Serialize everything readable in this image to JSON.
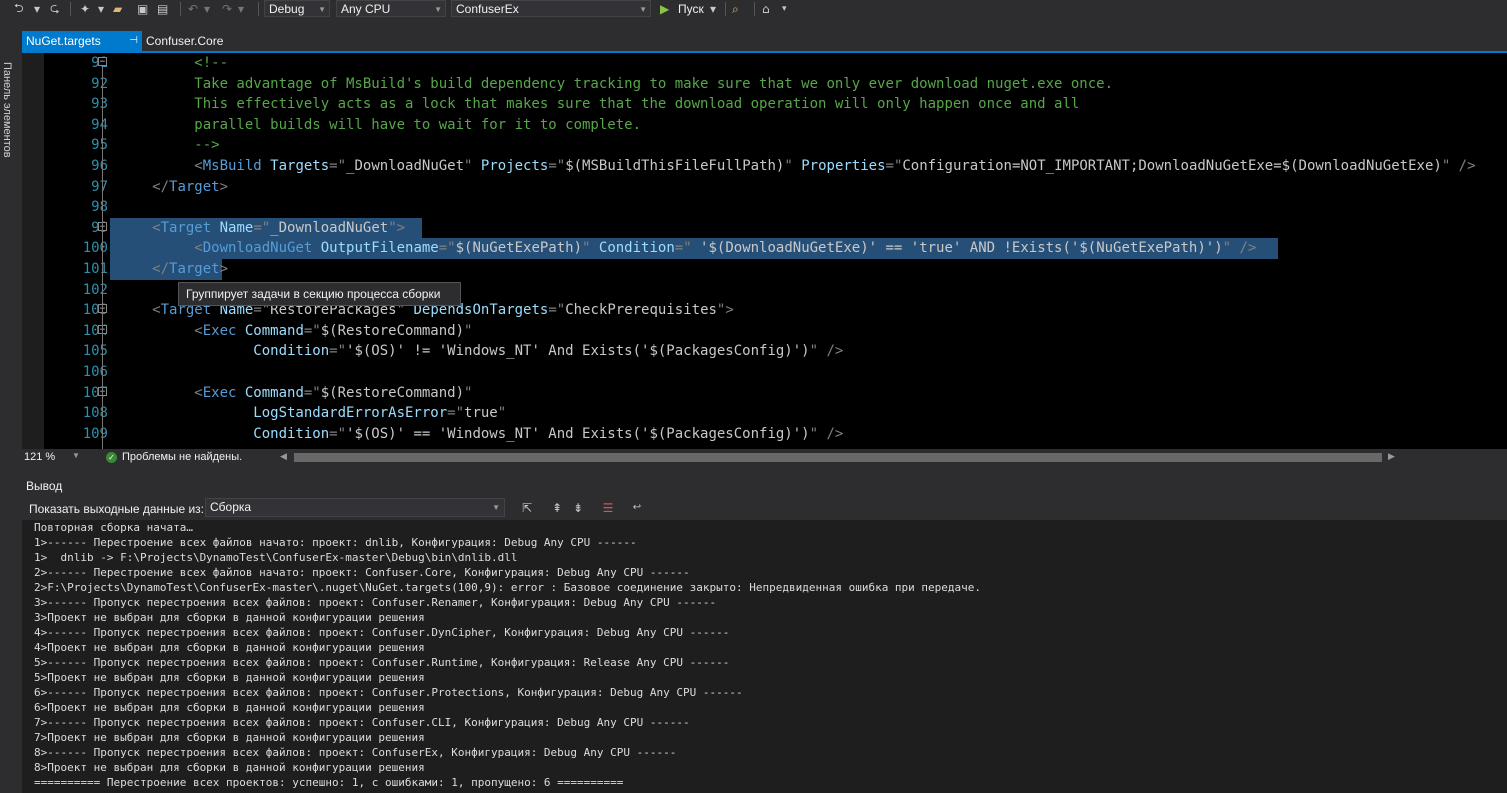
{
  "toolbar": {
    "config": "Debug",
    "platform": "Any CPU",
    "project": "ConfuserEx",
    "run_label": "Пуск"
  },
  "side_panel": {
    "label": "Панель элементов"
  },
  "tabs": [
    {
      "label": "NuGet.targets",
      "pin": "⊣"
    },
    {
      "label": "Confuser.Core"
    }
  ],
  "editor": {
    "lines": [
      {
        "n": "91",
        "fold": "⊟",
        "segs": [
          {
            "c": "c-com",
            "t": "          <!--"
          }
        ]
      },
      {
        "n": "92",
        "segs": [
          {
            "c": "c-com",
            "t": "          Take advantage of MsBuild's build dependency tracking to make sure that we only ever download nuget.exe once."
          }
        ]
      },
      {
        "n": "93",
        "segs": [
          {
            "c": "c-com",
            "t": "          This effectively acts as a lock that makes sure that the download operation will only happen once and all"
          }
        ]
      },
      {
        "n": "94",
        "segs": [
          {
            "c": "c-com",
            "t": "          parallel builds will have to wait for it to complete."
          }
        ]
      },
      {
        "n": "95",
        "segs": [
          {
            "c": "c-com",
            "t": "          -->"
          }
        ]
      },
      {
        "n": "96",
        "segs": [
          {
            "c": "c-pun",
            "t": "          <"
          },
          {
            "c": "c-tag",
            "t": "MsBuild"
          },
          {
            "c": "c-att",
            "t": " Targets"
          },
          {
            "c": "c-pun",
            "t": "=\""
          },
          {
            "c": "c-str",
            "t": "_DownloadNuGet"
          },
          {
            "c": "c-pun",
            "t": "\""
          },
          {
            "c": "c-att",
            "t": " Projects"
          },
          {
            "c": "c-pun",
            "t": "=\""
          },
          {
            "c": "c-str",
            "t": "$(MSBuildThisFileFullPath)"
          },
          {
            "c": "c-pun",
            "t": "\""
          },
          {
            "c": "c-att",
            "t": " Properties"
          },
          {
            "c": "c-pun",
            "t": "=\""
          },
          {
            "c": "c-str",
            "t": "Configuration=NOT_IMPORTANT;DownloadNuGetExe=$(DownloadNuGetExe)"
          },
          {
            "c": "c-pun",
            "t": "\" />"
          }
        ]
      },
      {
        "n": "97",
        "segs": [
          {
            "c": "c-pun",
            "t": "     </"
          },
          {
            "c": "c-tag",
            "t": "Target"
          },
          {
            "c": "c-pun",
            "t": ">"
          }
        ]
      },
      {
        "n": "98",
        "segs": [
          {
            "c": "c-pun",
            "t": ""
          }
        ]
      },
      {
        "n": "99",
        "fold": "⊟",
        "sel": true,
        "segs": [
          {
            "c": "c-pun",
            "t": "     <"
          },
          {
            "c": "c-tag",
            "t": "Target"
          },
          {
            "c": "c-att",
            "t": " Name"
          },
          {
            "c": "c-pun",
            "t": "=\""
          },
          {
            "c": "c-str",
            "t": "_DownloadNuGet"
          },
          {
            "c": "c-pun",
            "t": "\">"
          }
        ]
      },
      {
        "n": "100",
        "sel": true,
        "segs": [
          {
            "c": "c-pun",
            "t": "          <"
          },
          {
            "c": "c-tag",
            "t": "DownloadNuGet"
          },
          {
            "c": "c-att",
            "t": " OutputFilename"
          },
          {
            "c": "c-pun",
            "t": "=\""
          },
          {
            "c": "c-str",
            "t": "$(NuGetExePath)"
          },
          {
            "c": "c-pun",
            "t": "\""
          },
          {
            "c": "c-att",
            "t": " Condition"
          },
          {
            "c": "c-pun",
            "t": "=\""
          },
          {
            "c": "c-str",
            "t": " '$(DownloadNuGetExe)' == 'true' AND !Exists('$(NuGetExePath)')"
          },
          {
            "c": "c-pun",
            "t": "\" />"
          }
        ]
      },
      {
        "n": "101",
        "sel": true,
        "segs": [
          {
            "c": "c-pun",
            "t": "     </"
          },
          {
            "c": "c-tag",
            "t": "Target"
          },
          {
            "c": "c-pun",
            "t": ">"
          }
        ]
      },
      {
        "n": "102",
        "segs": [
          {
            "c": "c-pun",
            "t": ""
          }
        ]
      },
      {
        "n": "103",
        "fold": "⊟",
        "segs": [
          {
            "c": "c-pun",
            "t": "     <"
          },
          {
            "c": "c-tag",
            "t": "Target"
          },
          {
            "c": "c-att",
            "t": " Name"
          },
          {
            "c": "c-pun",
            "t": "=\""
          },
          {
            "c": "c-str",
            "t": "RestorePackages"
          },
          {
            "c": "c-pun",
            "t": "\""
          },
          {
            "c": "c-att",
            "t": " DependsOnTargets"
          },
          {
            "c": "c-pun",
            "t": "=\""
          },
          {
            "c": "c-str",
            "t": "CheckPrerequisites"
          },
          {
            "c": "c-pun",
            "t": "\">"
          }
        ]
      },
      {
        "n": "104",
        "fold": "⊟",
        "segs": [
          {
            "c": "c-pun",
            "t": "          <"
          },
          {
            "c": "c-tag",
            "t": "Exec"
          },
          {
            "c": "c-att",
            "t": " Command"
          },
          {
            "c": "c-pun",
            "t": "=\""
          },
          {
            "c": "c-str",
            "t": "$(RestoreCommand)"
          },
          {
            "c": "c-pun",
            "t": "\""
          }
        ]
      },
      {
        "n": "105",
        "segs": [
          {
            "c": "c-att",
            "t": "                 Condition"
          },
          {
            "c": "c-pun",
            "t": "=\""
          },
          {
            "c": "c-str",
            "t": "'$(OS)' != 'Windows_NT' And Exists('$(PackagesConfig)')"
          },
          {
            "c": "c-pun",
            "t": "\" />"
          }
        ]
      },
      {
        "n": "106",
        "segs": [
          {
            "c": "c-pun",
            "t": ""
          }
        ]
      },
      {
        "n": "107",
        "fold": "⊟",
        "segs": [
          {
            "c": "c-pun",
            "t": "          <"
          },
          {
            "c": "c-tag",
            "t": "Exec"
          },
          {
            "c": "c-att",
            "t": " Command"
          },
          {
            "c": "c-pun",
            "t": "=\""
          },
          {
            "c": "c-str",
            "t": "$(RestoreCommand)"
          },
          {
            "c": "c-pun",
            "t": "\""
          }
        ]
      },
      {
        "n": "108",
        "segs": [
          {
            "c": "c-att",
            "t": "                 LogStandardErrorAsError"
          },
          {
            "c": "c-pun",
            "t": "=\""
          },
          {
            "c": "c-str",
            "t": "true"
          },
          {
            "c": "c-pun",
            "t": "\""
          }
        ]
      },
      {
        "n": "109",
        "segs": [
          {
            "c": "c-att",
            "t": "                 Condition"
          },
          {
            "c": "c-pun",
            "t": "=\""
          },
          {
            "c": "c-str",
            "t": "'$(OS)' == 'Windows_NT' And Exists('$(PackagesConfig)')"
          },
          {
            "c": "c-pun",
            "t": "\" />"
          }
        ]
      }
    ]
  },
  "tooltip": "Группирует задачи в секцию процесса сборки",
  "status": {
    "zoom": "121 %",
    "issues": "Проблемы не найдены."
  },
  "output": {
    "title": "Вывод",
    "show_label": "Показать выходные данные из:",
    "source": "Сборка",
    "lines": [
      "Повторная сборка начата…",
      "1>------ Перестроение всех файлов начато: проект: dnlib, Конфигурация: Debug Any CPU ------",
      "1>  dnlib -> F:\\Projects\\DynamoTest\\ConfuserEx-master\\Debug\\bin\\dnlib.dll",
      "2>------ Перестроение всех файлов начато: проект: Confuser.Core, Конфигурация: Debug Any CPU ------",
      "2>F:\\Projects\\DynamoTest\\ConfuserEx-master\\.nuget\\NuGet.targets(100,9): error : Базовое соединение закрыто: Непредвиденная ошибка при передаче.",
      "3>------ Пропуск перестроения всех файлов: проект: Confuser.Renamer, Конфигурация: Debug Any CPU ------",
      "3>Проект не выбран для сборки в данной конфигурации решения",
      "4>------ Пропуск перестроения всех файлов: проект: Confuser.DynCipher, Конфигурация: Debug Any CPU ------",
      "4>Проект не выбран для сборки в данной конфигурации решения",
      "5>------ Пропуск перестроения всех файлов: проект: Confuser.Runtime, Конфигурация: Release Any CPU ------",
      "5>Проект не выбран для сборки в данной конфигурации решения",
      "6>------ Пропуск перестроения всех файлов: проект: Confuser.Protections, Конфигурация: Debug Any CPU ------",
      "6>Проект не выбран для сборки в данной конфигурации решения",
      "7>------ Пропуск перестроения всех файлов: проект: Confuser.CLI, Конфигурация: Debug Any CPU ------",
      "7>Проект не выбран для сборки в данной конфигурации решения",
      "8>------ Пропуск перестроения всех файлов: проект: ConfuserEx, Конфигурация: Debug Any CPU ------",
      "8>Проект не выбран для сборки в данной конфигурации решения",
      "========== Перестроение всех проектов: успешно: 1, с ошибками: 1, пропущено: 6 =========="
    ]
  }
}
